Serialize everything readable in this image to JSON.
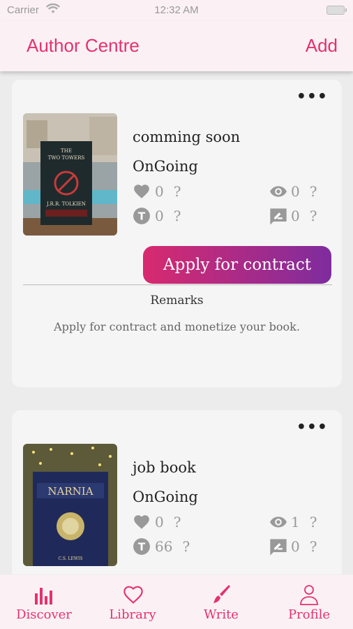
{
  "status_bar": {
    "carrier": "Carrier",
    "time": "12:32 AM"
  },
  "header": {
    "title": "Author Centre",
    "add_label": "Add"
  },
  "books": [
    {
      "title": "comming soon",
      "status": "OnGoing",
      "likes": "0",
      "views": "0",
      "tickets": "0",
      "comments": "0",
      "unknown": "?",
      "cover": {
        "series": "THE TWO TOWERS",
        "author": "J.R.R. TOLKIEN"
      },
      "apply_label": "Apply for contract",
      "remarks_label": "Remarks",
      "remarks_text": "Apply for contract and monetize your book."
    },
    {
      "title": "job book",
      "status": "OnGoing",
      "likes": "0",
      "views": "1",
      "tickets": "66",
      "comments": "0",
      "unknown": "?",
      "cover": {
        "series": "NARNIA",
        "author": "C.S. LEWIS"
      }
    }
  ],
  "tabs": [
    {
      "label": "Discover",
      "icon": "chart-bars-icon"
    },
    {
      "label": "Library",
      "icon": "heart-icon"
    },
    {
      "label": "Write",
      "icon": "brush-icon"
    },
    {
      "label": "Profile",
      "icon": "person-icon"
    }
  ],
  "colors": {
    "accent": "#e5316f",
    "gradient_start": "#d82a6f",
    "gradient_end": "#7e2c9e",
    "header_bg": "#fbf1f4"
  }
}
